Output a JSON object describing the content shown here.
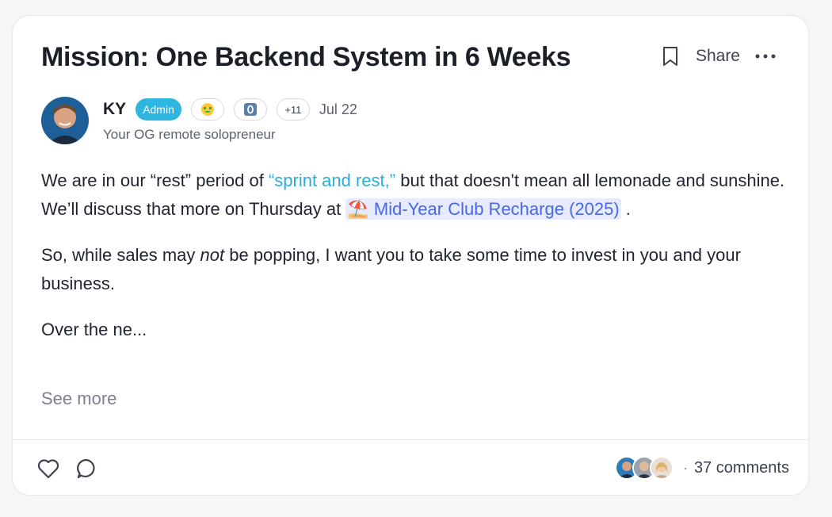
{
  "post": {
    "title": "Mission: One Backend System in 6 Weeks",
    "share_label": "Share",
    "author": {
      "name": "KY",
      "badge": "Admin",
      "chip_more": "+11",
      "date": "Jul 22",
      "subtitle": "Your OG remote solopreneur"
    },
    "paragraphs": {
      "p1_part1": "We are in our “rest” period of ",
      "p1_link": "“sprint and rest,”",
      "p1_part2": " but that doesn't mean all lemonade and sunshine. We’ll discuss that more on Thursday at ",
      "p1_event": "⛱️ Mid-Year Club Recharge (2025)",
      "p1_part3": " .",
      "p2_part1": "So, while sales may ",
      "p2_em": "not",
      "p2_part2": " be popping, I want you to take some time to invest in you and your business.",
      "p3": "Over the ne..."
    },
    "see_more": "See more",
    "comments": "37 comments",
    "comment_separator": "·"
  },
  "icons": {
    "bookmark": "bookmark-icon",
    "more": "more-horizontal-icon",
    "like": "heart-icon",
    "comment": "comment-bubble-icon"
  },
  "colors": {
    "admin_badge": "#2fb6e0",
    "link": "#2aaed8",
    "event_link": "#4a67e6",
    "event_bg": "#e6ecfd"
  }
}
